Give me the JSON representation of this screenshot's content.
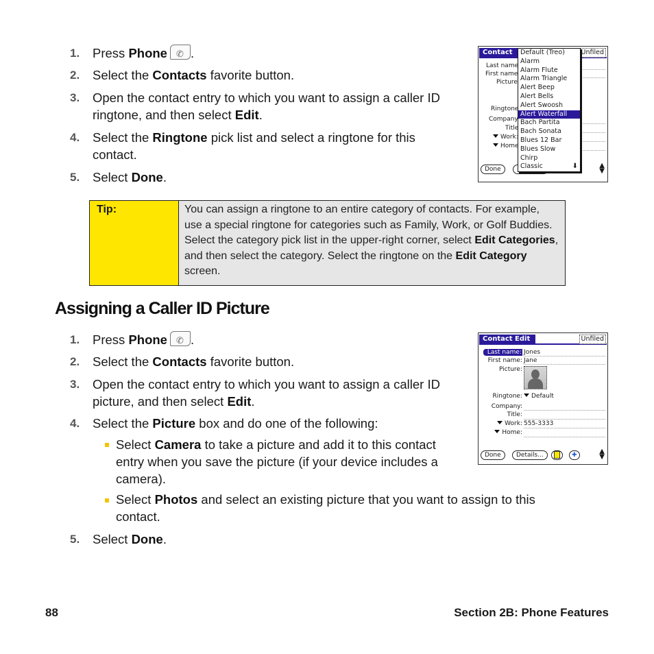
{
  "section1": {
    "steps": [
      {
        "num": "1.",
        "pre": "Press ",
        "bold": "Phone",
        "post": "."
      },
      {
        "num": "2.",
        "pre": "Select the ",
        "bold": "Contacts",
        "post": " favorite button."
      },
      {
        "num": "3.",
        "line1": "Open the contact entry to which you want to assign a caller ID",
        "line2_pre": "ringtone, and then select ",
        "line2_bold": "Edit",
        "line2_post": "."
      },
      {
        "num": "4.",
        "pre": "Select the ",
        "bold": "Ringtone",
        "post": " pick list and select a ringtone for this",
        "line2": "contact."
      },
      {
        "num": "5.",
        "pre": "Select ",
        "bold": "Done",
        "post": "."
      }
    ],
    "screen": {
      "title": "Contact",
      "category": "Unfiled",
      "labels": [
        "Last name:",
        "First name:",
        "Picture:",
        "Ringtone:",
        "Company:",
        "Title:",
        "Work:",
        "Home:"
      ],
      "ringtone_options": [
        "Default (Treo)",
        "Alarm",
        "Alarm Flute",
        "Alarm Triangle",
        "Alert Beep",
        "Alert Bells",
        "Alert Swoosh",
        "Alert Waterfall",
        "Bach Partita",
        "Bach Sonata",
        "Blues 12 Bar",
        "Blues Slow",
        "Chirp",
        "Classic"
      ],
      "selected_option": "Alert Waterfall",
      "done_button": "Done"
    }
  },
  "tip": {
    "label": "Tip:",
    "t1": "You can assign a ringtone to an entire category of contacts. For example, use a special ringtone for categories such as Family, Work, or Golf Buddies. Select the category pick list in the upper-right corner, select ",
    "b1": "Edit Categories",
    "t2": ", and then select the category. Select the ringtone on the ",
    "b2": "Edit Category",
    "t3": " screen."
  },
  "heading": "Assigning a Caller ID Picture",
  "section2": {
    "steps": [
      {
        "num": "1.",
        "pre": "Press ",
        "bold": "Phone",
        "post": "."
      },
      {
        "num": "2.",
        "pre": "Select the ",
        "bold": "Contacts",
        "post": " favorite button."
      },
      {
        "num": "3.",
        "line1": "Open the contact entry to which you want to assign a caller ID",
        "line2_pre": "picture, and then select ",
        "line2_bold": "Edit",
        "line2_post": "."
      },
      {
        "num": "4.",
        "pre": "Select the ",
        "bold": "Picture",
        "post": " box and do one of the following:"
      },
      {
        "num": "5.",
        "pre": "Select ",
        "bold": "Done",
        "post": "."
      }
    ],
    "bullets": [
      {
        "pre": "Select ",
        "bold": "Camera",
        "l1": " to take a picture and add it to this contact",
        "l2": "entry when you save the picture (if your device includes a",
        "l3": "camera)."
      },
      {
        "pre": "Select ",
        "bold": "Photos",
        "l1": " and select an existing picture that you want to assign to this",
        "l2": "contact."
      }
    ],
    "screen": {
      "title": "Contact Edit",
      "category": "Unfiled",
      "fields": [
        {
          "label": "Last name:",
          "value": "Jones"
        },
        {
          "label": "First name:",
          "value": "Jane"
        },
        {
          "label": "Picture:",
          "value": ""
        },
        {
          "label": "Ringtone:",
          "value": "Default"
        },
        {
          "label": "Company:",
          "value": ""
        },
        {
          "label": "Title:",
          "value": ""
        },
        {
          "label": "Work:",
          "value": "555-3333"
        },
        {
          "label": "Home:",
          "value": ""
        }
      ],
      "done_button": "Done",
      "details_button": "Details..."
    }
  },
  "footer": {
    "page_number": "88",
    "section": "Section 2B: Phone Features"
  },
  "colors": {
    "tip_yellow": "#ffe600",
    "tip_gray": "#e6e6e6",
    "palm_title": "#2a1a9a",
    "bullet": "#f2c400"
  }
}
